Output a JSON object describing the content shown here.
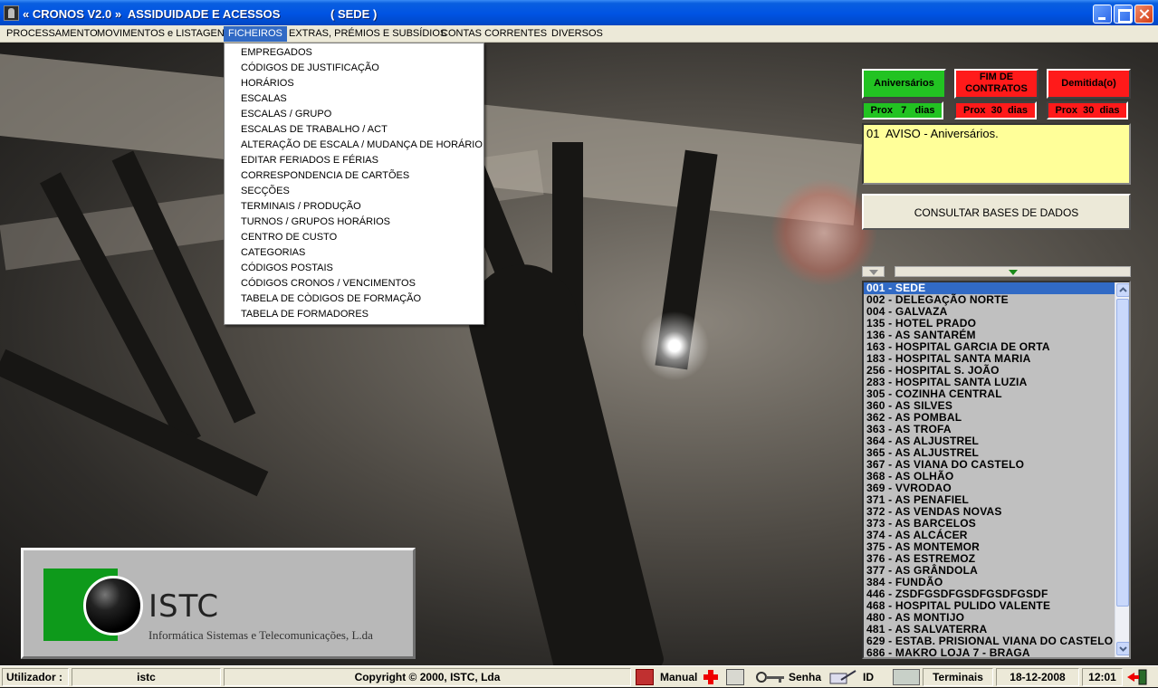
{
  "window": {
    "title": "« CRONOS V2.0 »  ASSIDUIDADE E ACESSOS",
    "site": "( SEDE )"
  },
  "menubar": [
    "PROCESSAMENTO",
    "MOVIMENTOS e LISTAGENS",
    "FICHEIROS",
    "EXTRAS, PRÉMIOS E SUBSÍDIOS",
    "CONTAS CORRENTES",
    "DIVERSOS"
  ],
  "active_menu": "FICHEIROS",
  "ficheiros_menu": [
    "EMPREGADOS",
    "CÓDIGOS DE JUSTIFICAÇÃO",
    "HORÁRIOS",
    "ESCALAS",
    "ESCALAS / GRUPO",
    "ESCALAS DE TRABALHO / ACT",
    "ALTERAÇÃO DE ESCALA / MUDANÇA DE HORÁRIO",
    "EDITAR FERIADOS E FÉRIAS",
    "CORRESPONDENCIA DE CARTÕES",
    "SECÇÕES",
    "TERMINAIS / PRODUÇÃO",
    "TURNOS / GRUPOS HORÁRIOS",
    "CENTRO DE CUSTO",
    "CATEGORIAS",
    "CÓDIGOS POSTAIS",
    "CÓDIGOS CRONOS / VENCIMENTOS",
    "TABELA DE CÒDIGOS DE FORMAÇÃO",
    "TABELA DE FORMADORES"
  ],
  "alerts": {
    "aniversarios": {
      "label": "Aniversários",
      "prox": "Prox   7   dias",
      "color": "#22c322"
    },
    "fim_contratos": {
      "label": "FIM DE CONTRATOS",
      "prox": "Prox  30  dias",
      "color": "#ff1a1a"
    },
    "demitidos": {
      "label": "Demitida(o)",
      "prox": "Prox  30  dias",
      "color": "#ff1a1a"
    }
  },
  "notice": "01  AVISO - Aniversários.",
  "consult_label": "CONSULTAR BASES DE DADOS",
  "sites": [
    "001 - SEDE",
    "002 - DELEGAÇÃO NORTE",
    "004 - GALVAZA",
    "135 - HOTEL PRADO",
    "136 - AS SANTARÉM",
    "163 - HOSPITAL GARCIA DE ORTA",
    "183 - HOSPITAL SANTA MARIA",
    "256 - HOSPITAL S. JOÃO",
    "283 - HOSPITAL SANTA LUZIA",
    "305 - COZINHA CENTRAL",
    "360 - AS SILVES",
    "362 - AS POMBAL",
    "363 - AS TROFA",
    "364 - AS ALJUSTREL",
    "365 - AS ALJUSTREL",
    "367 - AS VIANA DO CASTELO",
    "368 - AS OLHÃO",
    "369 - VVRODAO",
    "371 - AS PENAFIEL",
    "372 - AS VENDAS NOVAS",
    "373 - AS BARCELOS",
    "374 - AS ALCÁCER",
    "375 - AS MONTEMOR",
    "376 - AS ESTREMOZ",
    "377 - AS GRÂNDOLA",
    "384 - FUNDÃO",
    "446 - ZSDFGSDFGSDFGSDFGSDF",
    "468 - HOSPITAL PULIDO VALENTE",
    "480 - AS MONTIJO",
    "481 - AS SALVATERRA",
    "629 - ESTAB. PRISIONAL VIANA DO CASTELO",
    "686 - MAKRO LOJA 7 - BRAGA"
  ],
  "selected_site": "001 - SEDE",
  "logo": {
    "name": "ISTC",
    "subtitle": "Informática Sistemas e Telecomunicações, L.da"
  },
  "statusbar": {
    "user_label": "Utilizador :",
    "user": "istc",
    "copyright": "Copyright © 2000, ISTC, Lda",
    "manual": "Manual",
    "senha": "Senha",
    "id": "ID",
    "terminais": "Terminais",
    "date": "18-12-2008",
    "time": "12:01"
  }
}
